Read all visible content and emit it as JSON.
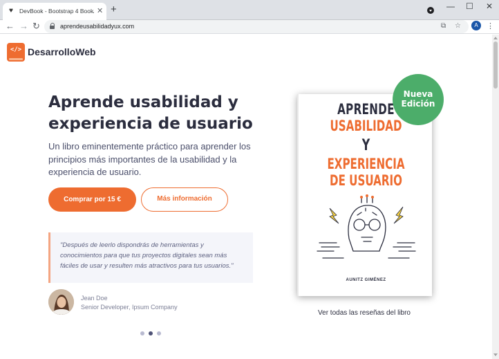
{
  "browser": {
    "tab_title": "DevBook - Bootstrap 4 Book/eBo",
    "tab_close": "✕",
    "new_tab": "+",
    "url": "aprendeusabilidadyux.com",
    "profile_initial": "A",
    "window_controls": {
      "minimize": "—",
      "maximize": "☐",
      "close": "✕"
    },
    "icons": [
      "back-icon",
      "forward-icon",
      "reload-icon",
      "lock-icon",
      "translate-icon",
      "star-icon",
      "kebab-menu-icon"
    ]
  },
  "nav": {
    "brand": "DesarrolloWeb",
    "logo_glyph": "</>"
  },
  "hero": {
    "headline": "Aprende usabilidad y experiencia de usuario",
    "lead": "Un libro eminentemente práctico para aprender los principios más importantes de la usabilidad y la experiencia de usuario.",
    "buy_button": "Comprar por 15 €",
    "info_button": "Más información"
  },
  "testimonial": {
    "quote": "\"Después de leerlo dispondrás de herramientas y conocimientos para que tus proyectos digitales sean más fáciles de usar y resulten más atractivos para tus usuarios.\"",
    "author": "Jean Doe",
    "role": "Senior Developer, Ipsum Company"
  },
  "carousel": {
    "count": 3,
    "active_index": 1
  },
  "book": {
    "line1": "APRENDE",
    "line2": "USABILIDAD",
    "line3": "Y",
    "line4": "EXPERIENCIA",
    "line5": "DE USUARIO",
    "author": "AUNITZ GIMÉNEZ",
    "badge_line1": "Nueva",
    "badge_line2": "Edición"
  },
  "reviews_link": "Ver todas las reseñas del libro",
  "colors": {
    "accent": "#ee6c30",
    "badge": "#4cad6a",
    "heading": "#2b2d3e",
    "body_text": "#4a4e6a"
  }
}
